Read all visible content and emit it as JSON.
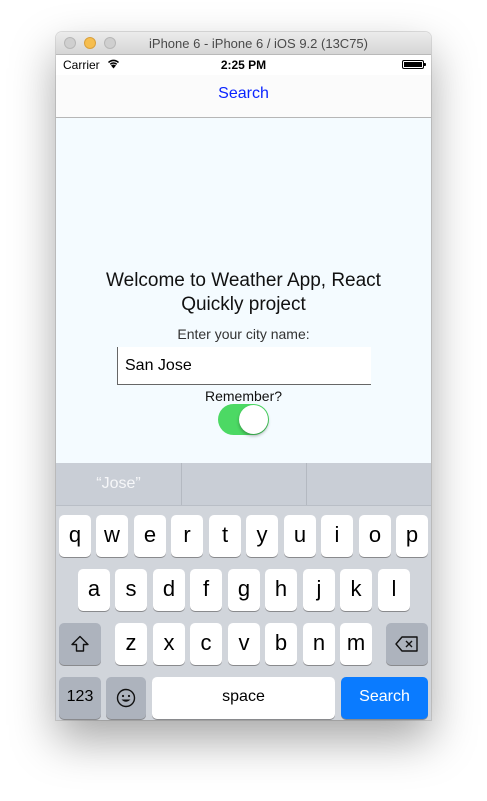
{
  "window": {
    "title": "iPhone 6 - iPhone 6 / iOS 9.2 (13C75)"
  },
  "statusbar": {
    "carrier": "Carrier",
    "time": "2:25 PM"
  },
  "navbar": {
    "title": "Search"
  },
  "main": {
    "welcome": "Welcome to Weather App, React Quickly project",
    "prompt": "Enter your city name:",
    "city_value": "San Jose",
    "remember_label": "Remember?",
    "remember_on": true
  },
  "keyboard": {
    "suggestions": [
      "“Jose”",
      "",
      ""
    ],
    "row1": [
      "q",
      "w",
      "e",
      "r",
      "t",
      "y",
      "u",
      "i",
      "o",
      "p"
    ],
    "row2": [
      "a",
      "s",
      "d",
      "f",
      "g",
      "h",
      "j",
      "k",
      "l"
    ],
    "row3": [
      "z",
      "x",
      "c",
      "v",
      "b",
      "n",
      "m"
    ],
    "numbers_label": "123",
    "space_label": "space",
    "return_label": "Search"
  },
  "colors": {
    "accent": "#0a24ff",
    "switch_on": "#4cd964",
    "search_key": "#0a7bff"
  }
}
